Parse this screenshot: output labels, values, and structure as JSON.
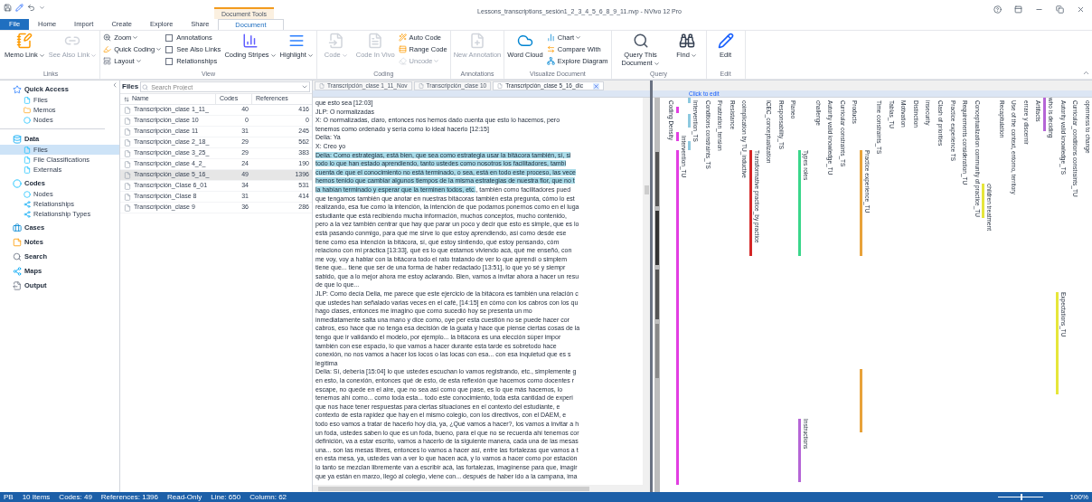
{
  "window": {
    "title": "Lessons_transcriptions_sesión1_2_3_4_5_6_8_9_11.nvp - NVivo 12 Pro",
    "context_tab_group": "Document Tools"
  },
  "tabs": [
    {
      "label": "File",
      "selected": false,
      "kind": "file"
    },
    {
      "label": "Home",
      "selected": false
    },
    {
      "label": "Import",
      "selected": false
    },
    {
      "label": "Create",
      "selected": false
    },
    {
      "label": "Explore",
      "selected": false
    },
    {
      "label": "Share",
      "selected": false
    },
    {
      "label": "Document",
      "selected": true
    }
  ],
  "ribbon": [
    {
      "label": "Links",
      "items": [
        {
          "kind": "large",
          "label": "Memo Link",
          "caret": true,
          "disabled": false
        },
        {
          "kind": "large",
          "label": "See Also Link",
          "caret": true,
          "disabled": true
        }
      ]
    },
    {
      "label": "View",
      "items": [
        {
          "kind": "small",
          "label": "Zoom",
          "caret": true,
          "disabled": false
        },
        {
          "kind": "small",
          "label": "Quick Coding",
          "caret": true,
          "disabled": false
        },
        {
          "kind": "small",
          "label": "Layout",
          "caret": true,
          "disabled": false
        },
        {
          "kind": "check",
          "label": "Annotations",
          "checked": false
        },
        {
          "kind": "check",
          "label": "See Also Links",
          "checked": false
        },
        {
          "kind": "check",
          "label": "Relationships",
          "checked": false
        },
        {
          "kind": "large",
          "label": "Coding Stripes",
          "caret": true,
          "disabled": false
        },
        {
          "kind": "large",
          "label": "Highlight",
          "caret": true,
          "disabled": false
        }
      ]
    },
    {
      "label": "Coding",
      "items": [
        {
          "kind": "large",
          "label": "Code",
          "caret": true,
          "disabled": true
        },
        {
          "kind": "large",
          "label": "Code In Vivo",
          "caret": false,
          "disabled": true
        },
        {
          "kind": "small",
          "label": "Auto Code",
          "caret": false,
          "disabled": false
        },
        {
          "kind": "small",
          "label": "Range Code",
          "caret": false,
          "disabled": false
        },
        {
          "kind": "small",
          "label": "Uncode",
          "caret": true,
          "disabled": true
        }
      ]
    },
    {
      "label": "Annotations",
      "items": [
        {
          "kind": "large",
          "label": "New Annotation",
          "caret": false,
          "disabled": true
        }
      ]
    },
    {
      "label": "Visualize Document",
      "items": [
        {
          "kind": "large",
          "label": "Word Cloud",
          "caret": false,
          "disabled": false
        },
        {
          "kind": "small",
          "label": "Chart",
          "caret": true,
          "disabled": false
        },
        {
          "kind": "small",
          "label": "Compare With",
          "caret": false,
          "disabled": false
        },
        {
          "kind": "small",
          "label": "Explore Diagram",
          "caret": false,
          "disabled": false
        }
      ]
    },
    {
      "label": "Query",
      "items": [
        {
          "kind": "large",
          "label": "Query This Document",
          "caret": true,
          "disabled": false
        },
        {
          "kind": "large",
          "label": "Find",
          "caret": true,
          "disabled": false
        }
      ]
    },
    {
      "label": "Edit",
      "items": [
        {
          "kind": "large",
          "label": "Edit",
          "caret": false,
          "disabled": false
        }
      ]
    }
  ],
  "navigation": [
    {
      "label": "Quick Access",
      "children": [
        {
          "label": "Files",
          "selected": false
        },
        {
          "label": "Memos",
          "selected": false
        },
        {
          "label": "Nodes",
          "selected": false
        }
      ]
    },
    {
      "label": "Data",
      "children": [
        {
          "label": "Files",
          "selected": true
        },
        {
          "label": "File Classifications",
          "selected": false
        },
        {
          "label": "Externals",
          "selected": false
        }
      ]
    },
    {
      "label": "Codes",
      "children": [
        {
          "label": "Nodes",
          "selected": false
        },
        {
          "label": "Relationships",
          "selected": false
        },
        {
          "label": "Relationship Types",
          "selected": false
        }
      ]
    },
    {
      "label": "Cases"
    },
    {
      "label": "Notes"
    },
    {
      "label": "Search"
    },
    {
      "label": "Maps"
    },
    {
      "label": "Output"
    }
  ],
  "files": {
    "title": "Files",
    "search": {
      "placeholder": "Search Project"
    },
    "columns": [
      "Name",
      "Codes",
      "References"
    ],
    "rows": [
      {
        "name": "Transcripción_clase 1_11_",
        "codes": "40",
        "references": "416",
        "selected": false
      },
      {
        "name": "Transcripción_clase 10",
        "codes": "0",
        "references": "0",
        "selected": false
      },
      {
        "name": "Transcripción_clase 11",
        "codes": "31",
        "references": "245",
        "selected": false
      },
      {
        "name": "Transcripción_clase 2_18_",
        "codes": "29",
        "references": "562",
        "selected": false
      },
      {
        "name": "Transcripción_clase 3_25_",
        "codes": "29",
        "references": "383",
        "selected": false
      },
      {
        "name": "Transcripción_clase 4_2_",
        "codes": "24",
        "references": "190",
        "selected": false
      },
      {
        "name": "Transcripción_clase 5_16_",
        "codes": "49",
        "references": "1396",
        "selected": true
      },
      {
        "name": "Transcripción_Clase 6_01",
        "codes": "34",
        "references": "531",
        "selected": false
      },
      {
        "name": "Transcripción_Clase 8",
        "codes": "31",
        "references": "414",
        "selected": false
      },
      {
        "name": "Transcripción_clase 9",
        "codes": "36",
        "references": "286",
        "selected": false
      }
    ]
  },
  "document": {
    "tabs": [
      {
        "label": "Transcripción_clase 1_11_Nov",
        "selected": false
      },
      {
        "label": "Transcripción_clase 10",
        "selected": false
      },
      {
        "label": "Transcripción_clase 5_16_dic",
        "selected": true
      }
    ],
    "lines": [
      {
        "parts": [
          {
            "text": "que esto sea [12:03]",
            "highlighted": false
          }
        ]
      },
      {
        "parts": [
          {
            "text": "JLP: O normalizadas",
            "highlighted": false
          }
        ]
      },
      {
        "parts": [
          {
            "text": "X: O normalizadas, claro, entonces nos hemos dado cuenta que esto lo hacemos, pero",
            "highlighted": false
          }
        ]
      },
      {
        "parts": [
          {
            "text": "tenemos como ordenado y sería como lo ideal hacerlo [12:15]",
            "highlighted": false
          }
        ]
      },
      {
        "parts": [
          {
            "text": "Delia: Ya",
            "highlighted": false
          }
        ]
      },
      {
        "parts": [
          {
            "text": "X: Creo yo",
            "highlighted": false
          }
        ]
      },
      {
        "parts": [
          {
            "text": "Delia: Como estrategias, está bien, que sea como estrategia usar la bitácora también, sí, si",
            "highlighted": true
          }
        ]
      },
      {
        "parts": [
          {
            "text": "todo lo que han estado aprendiendo, tanto ustedes como nosotros los facilitadores, tambi",
            "highlighted": true
          }
        ]
      },
      {
        "parts": [
          {
            "text": "cuenta de que el conocimiento no está terminado, o sea, está en todo este proceso, las vece",
            "highlighted": true
          }
        ]
      },
      {
        "parts": [
          {
            "text": "hemos tenido que cambiar algunos tiempos de la misma estrategias de nuestra flor, que no t",
            "highlighted": true
          }
        ]
      },
      {
        "parts": [
          {
            "text": "la habían terminado y esperar que la terminen todos, etc.",
            "highlighted": true
          },
          {
            "text": ", también como facilitadores pued",
            "highlighted": false
          }
        ]
      },
      {
        "parts": [
          {
            "text": "que tengamos también que anotar en nuestras bitácoras también esta pregunta, cómo lo est",
            "highlighted": false
          }
        ]
      },
      {
        "parts": [
          {
            "text": "realizando, esa fue como la intención, la intención de que podamos ponernos como en el luga",
            "highlighted": false
          }
        ]
      },
      {
        "parts": [
          {
            "text": "estudiante que está recibiendo mucha información, muchos conceptos, mucho contenido,",
            "highlighted": false
          }
        ]
      },
      {
        "parts": [
          {
            "text": "pero a la vez también centrar que hay que parar un poco y decir que esto es simple, que es lo",
            "highlighted": false
          }
        ]
      },
      {
        "parts": [
          {
            "text": "está pasando conmigo, para qué me sirve lo que estoy aprendiendo, así como desde ese",
            "highlighted": false
          }
        ]
      },
      {
        "parts": [
          {
            "text": "tiene como esa intención la bitácora, sí, qué estoy sintiendo, qué estoy pensando, cóm",
            "highlighted": false
          }
        ]
      },
      {
        "parts": [
          {
            "text": "relaciono con mi práctica [13:33], qué es lo que estamos viviendo acá, qué me enseñó, con",
            "highlighted": false
          }
        ]
      },
      {
        "parts": [
          {
            "text": "me voy, voy a hablar con la bitácora todo el rato tratando de ver lo que aprendí o simplem",
            "highlighted": false
          }
        ]
      },
      {
        "parts": [
          {
            "text": "tiene que... tiene que ser de una forma de haber redactado [13:51], lo que yo sé y siempr",
            "highlighted": false
          }
        ]
      },
      {
        "parts": [
          {
            "text": "sabido, que a lo mejor ahora me estoy aclarando. Bien, vamos a invitar ahora a hacer un resu",
            "highlighted": false
          }
        ]
      },
      {
        "parts": [
          {
            "text": "de que lo que...",
            "highlighted": false
          }
        ]
      },
      {
        "parts": [
          {
            "text": "JLP: Como decía Delia, me parece que este ejercicio de la bitácora es también una relación c",
            "highlighted": false
          }
        ]
      },
      {
        "parts": [
          {
            "text": "que ustedes han señalado varias veces en el café, [14:15] en cómo con los cabros con los qu",
            "highlighted": false
          }
        ]
      },
      {
        "parts": [
          {
            "text": "hago clases, entonces me imagino que como sucedió hoy se presenta un mo",
            "highlighted": false
          }
        ]
      },
      {
        "parts": [
          {
            "text": "inmediatamente salta una mano y dice como, oye per esta cuestión no se puede hacer cor",
            "highlighted": false
          }
        ]
      },
      {
        "parts": [
          {
            "text": "cabros, eso hace que no tenga esa decisión de la guata y hace que piense ciertas cosas de la",
            "highlighted": false
          }
        ]
      },
      {
        "parts": [
          {
            "text": "tengo que ir validando el modelo, por ejemplo... la bitácora es una elección súper impor",
            "highlighted": false
          }
        ]
      },
      {
        "parts": [
          {
            "text": "también con ese espacio, lo que vamos a hacer durante esta tarde es sobretodo hace",
            "highlighted": false
          }
        ]
      },
      {
        "parts": [
          {
            "text": "conexión, no nos vamos a hacer los locos o las locas con esa... con esa inquietud que es s",
            "highlighted": false
          }
        ]
      },
      {
        "parts": [
          {
            "text": "legítima",
            "highlighted": false
          }
        ]
      },
      {
        "parts": [
          {
            "text": "Delia: Sí, debería [15:04] lo que ustedes escuchan lo vamos registrando, etc., simplemente g",
            "highlighted": false
          }
        ]
      },
      {
        "parts": [
          {
            "text": "en esto, la conexión, entonces qué de esto, de esta reflexión que hacemos como docentes r",
            "highlighted": false
          }
        ]
      },
      {
        "parts": [
          {
            "text": "escape, no quede en el aire, que no sea así como que pase, es lo que más hacemos, lo",
            "highlighted": false
          }
        ]
      },
      {
        "parts": [
          {
            "text": "tenemos ahí como... como toda esta... todo este conocimiento, toda esta cantidad de experi",
            "highlighted": false
          }
        ]
      },
      {
        "parts": [
          {
            "text": "que nos hace tener respuestas para ciertas situaciones en el contexto del estudiante, e",
            "highlighted": false
          }
        ]
      },
      {
        "parts": [
          {
            "text": "contexto de esta rapidez que hay en el mismo colegio, con los directivos, con el DAEM, e",
            "highlighted": false
          }
        ]
      },
      {
        "parts": [
          {
            "text": "todo eso vamos a tratar de hacerlo hoy día, ya, ¿Qué vamos a hacer?, los vamos a invitar a h",
            "highlighted": false
          }
        ]
      },
      {
        "parts": [
          {
            "text": "un foda, ustedes saben lo que es un foda, bueno, para el que no se recuerda ahí tenemos cor",
            "highlighted": false
          }
        ]
      },
      {
        "parts": [
          {
            "text": "definición, va a estar escrito, vamos a hacerlo de la siguiente manera, cada una de las mesas",
            "highlighted": false
          }
        ]
      },
      {
        "parts": [
          {
            "text": "una... son las mesas libres, entonces lo vamos a hacer así, entre las fortalezas que vamos a t",
            "highlighted": false
          }
        ]
      },
      {
        "parts": [
          {
            "text": "en esta mesa, ya, ustedes van a ver lo que hacen acá, y lo vamos a hacer como por estación",
            "highlighted": false
          }
        ]
      },
      {
        "parts": [
          {
            "text": "lo tanto se mezclan libremente van a escribir acá, las fortalezas, imagínense para que, imagir",
            "highlighted": false
          }
        ]
      },
      {
        "parts": [
          {
            "text": "que ya están en marzo, llegó al colegio, viene con... después de haber ido a la campana, ima",
            "highlighted": false
          }
        ]
      }
    ]
  },
  "coding_stripes": {
    "header": "Click to edit",
    "columns": [
      {
        "stripes": [
          {
            "label": "Coding Density"
          }
        ]
      },
      {
        "stripes": [
          {
            "label": "Intervention_TU",
            "color": "#e23ee2"
          }
        ]
      },
      {
        "stripes": [
          {
            "label": "Intervention_TS",
            "color": "#8ec9df"
          }
        ]
      },
      {
        "stripes": [
          {
            "label": "Conditions constraints_TS"
          }
        ]
      },
      {
        "stripes": [
          {
            "label": "Frustration_tension"
          }
        ]
      },
      {
        "stripes": [
          {
            "label": "Resistance"
          }
        ]
      },
      {
        "stripes": [
          {
            "label": "coimplication by TU_inductive"
          }
        ]
      },
      {
        "stripes": [
          {
            "label": "Transformative practice_by practice",
            "color": "#d42626"
          }
        ]
      },
      {
        "stripes": [
          {
            "label": "ICEC_conceptualization"
          }
        ]
      },
      {
        "stripes": [
          {
            "label": "Responsability_TS"
          }
        ]
      },
      {
        "stripes": [
          {
            "label": "Planeo"
          }
        ]
      },
      {
        "stripes": [
          {
            "label": "Types roles",
            "color": "#3ad68a"
          },
          {
            "label": "Instructions",
            "color": "#b565d6"
          }
        ]
      },
      {
        "stripes": [
          {
            "label": "challenge"
          }
        ]
      },
      {
        "stripes": [
          {
            "label": "Autority valid knowledge_TU"
          }
        ]
      },
      {
        "stripes": [
          {
            "label": "Curricular constraints_TS"
          }
        ]
      },
      {
        "stripes": [
          {
            "label": "Products"
          }
        ]
      },
      {
        "stripes": [
          {
            "label": "Practice experience_TU",
            "color": "#e8a23a"
          }
        ]
      },
      {
        "stripes": [
          {
            "label": "Time constraints_TS"
          }
        ]
      },
      {
        "stripes": [
          {
            "label": "Tablas_TU"
          }
        ]
      },
      {
        "stripes": [
          {
            "label": "Motivation"
          }
        ]
      },
      {
        "stripes": [
          {
            "label": "Distinction"
          }
        ]
      },
      {
        "stripes": [
          {
            "label": "insecurity"
          }
        ]
      },
      {
        "stripes": [
          {
            "label": "Clash of priorities"
          }
        ]
      },
      {
        "stripes": [
          {
            "label": "Practice experience TS"
          }
        ]
      },
      {
        "stripes": [
          {
            "label": "Requirements consideration_TU"
          }
        ]
      },
      {
        "stripes": [
          {
            "label": "Conceptualization community of practice_TU"
          }
        ]
      },
      {
        "stripes": [
          {
            "label": "children treatment",
            "color": "#e6e63a"
          }
        ]
      },
      {
        "stripes": [
          {
            "label": "Recapitulation"
          }
        ]
      },
      {
        "stripes": [
          {
            "label": "Use of the context, entorno, territory"
          }
        ]
      },
      {
        "stripes": [
          {
            "label": "errare y discernir"
          }
        ]
      },
      {
        "stripes": [
          {
            "label": "Artifacts"
          }
        ]
      },
      {
        "stripes": [
          {
            "label": "who is deciding",
            "color": "#b565d6"
          }
        ]
      },
      {
        "stripes": [
          {
            "label": "Autority valid knowledge_TS"
          },
          {
            "label": "Expectations_TU",
            "color": "#e6e63a"
          }
        ]
      },
      {
        "stripes": [
          {
            "label": "Curricular_conditions constraints_TU"
          }
        ]
      },
      {
        "stripes": [
          {
            "label": "openness to change"
          }
        ]
      }
    ]
  },
  "status_bar": {
    "items": [
      "PB",
      "10 Items",
      "Codes: 49",
      "References: 1396",
      "Read-Only",
      "Line: 650",
      "Column: 62"
    ],
    "zoom": {
      "level": 0.5,
      "reading": "100%"
    }
  }
}
